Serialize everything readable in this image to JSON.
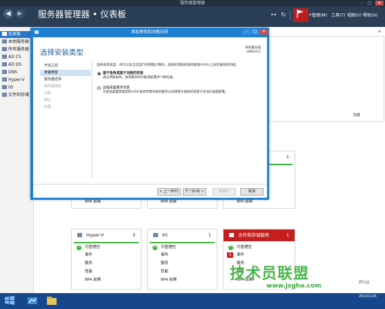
{
  "window": {
    "title": "服务器管理器"
  },
  "header": {
    "page_title": "服务器管理器 • 仪表板",
    "menus": [
      "管理(M)",
      "工具(T)",
      "视图(V)",
      "帮助(H)"
    ],
    "accent": "#2a3e55"
  },
  "sidebar": {
    "items": [
      {
        "label": "仪表板",
        "selected": true
      },
      {
        "label": "本地服务器"
      },
      {
        "label": "所有服务器"
      },
      {
        "label": "AD CS"
      },
      {
        "label": "AD DS"
      },
      {
        "label": "DNS"
      },
      {
        "label": "Hyper-V"
      },
      {
        "label": "IIS"
      },
      {
        "label": "文件和存储"
      }
    ]
  },
  "main": {
    "hide_link": "隐藏"
  },
  "dialog": {
    "title": "添加角色和功能向导",
    "heading": "选择安装类型",
    "target_label": "目标服务器",
    "target_value": "WIN2012",
    "nav_steps": [
      {
        "label": "开始之前",
        "state": "normal"
      },
      {
        "label": "安装类型",
        "state": "selected"
      },
      {
        "label": "服务器选择",
        "state": "normal"
      },
      {
        "label": "服务器角色",
        "state": "disabled"
      },
      {
        "label": "功能",
        "state": "disabled"
      },
      {
        "label": "确认",
        "state": "disabled"
      },
      {
        "label": "结果",
        "state": "disabled"
      }
    ],
    "description": "选择安装类型。你可以在正在运行的物理计算机、虚拟机或脱机虚拟硬盘(VHD)上安装角色和功能。",
    "options": [
      {
        "title": "基于角色或基于功能的安装",
        "desc": "通过添加角色、角色服务和功能来配置单个服务器。",
        "selected": true
      },
      {
        "title": "远程桌面服务安装",
        "desc": "为虚拟桌面基础结构(VDI)安装所需的角色服务以创建基于虚拟机或基于会话的桌面部署。",
        "selected": false
      }
    ],
    "buttons": {
      "prev": "< 上一步(P)",
      "next": "下一步(N) >",
      "install": "安装(I)",
      "cancel": "取消"
    }
  },
  "tiles": {
    "row1": [
      {
        "count": "1"
      }
    ],
    "row1_rows": [
      "BPA 结果",
      "BPA 结果",
      "BPA 结果"
    ],
    "row2": [
      {
        "name": "Hyper-V",
        "count": "3",
        "rows": [
          "可管理性",
          "事件",
          "服务",
          "性能",
          "BPA 结果"
        ]
      },
      {
        "name": "IIS",
        "count": "1",
        "rows": [
          "可管理性",
          "事件",
          "服务",
          "性能",
          "BPA 结果"
        ]
      },
      {
        "name": "文件和存储服务",
        "count": "1",
        "rows": [
          "可管理性",
          "事件",
          "服务",
          "性能",
          "BPA 结果"
        ],
        "badge": "3"
      }
    ]
  },
  "taskbar": {
    "time": "2013/1/26"
  },
  "watermark": {
    "main": "技术员联盟",
    "url": "www.jsgho.com",
    "blog": "Blog"
  }
}
